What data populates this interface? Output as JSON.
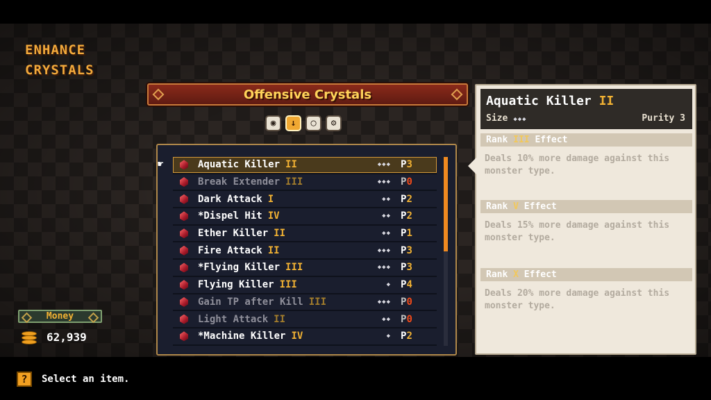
{
  "screen_title": [
    "ENHANCE",
    "CRYSTALS"
  ],
  "category": {
    "title": "Offensive Crystals",
    "icons": [
      "bag-icon",
      "sword-icon",
      "shield-icon",
      "gear-icon"
    ],
    "active_index": 1
  },
  "crystals": [
    {
      "name": "Aquatic Killer",
      "rank": "II",
      "size": "◆◆◆",
      "purity_prefix": "P",
      "purity": "3",
      "dim": false,
      "selected": true
    },
    {
      "name": "Break Extender",
      "rank": "III",
      "size": "◆◆◆",
      "purity_prefix": "P",
      "purity": "0",
      "dim": true,
      "selected": false
    },
    {
      "name": "Dark Attack",
      "rank": "I",
      "size": "◆◆",
      "purity_prefix": "P",
      "purity": "2",
      "dim": false,
      "selected": false
    },
    {
      "name": "*Dispel Hit",
      "rank": "IV",
      "size": "◆◆",
      "purity_prefix": "P",
      "purity": "2",
      "dim": false,
      "selected": false
    },
    {
      "name": "Ether Killer",
      "rank": "II",
      "size": "◆◆",
      "purity_prefix": "P",
      "purity": "1",
      "dim": false,
      "selected": false
    },
    {
      "name": "Fire Attack",
      "rank": "II",
      "size": "◆◆◆",
      "purity_prefix": "P",
      "purity": "3",
      "dim": false,
      "selected": false
    },
    {
      "name": "*Flying Killer",
      "rank": "III",
      "size": "◆◆◆",
      "purity_prefix": "P",
      "purity": "3",
      "dim": false,
      "selected": false
    },
    {
      "name": "Flying Killer",
      "rank": "III",
      "size": "◆",
      "purity_prefix": "P",
      "purity": "4",
      "dim": false,
      "selected": false
    },
    {
      "name": "Gain TP after Kill",
      "rank": "III",
      "size": "◆◆◆",
      "purity_prefix": "P",
      "purity": "0",
      "dim": true,
      "selected": false
    },
    {
      "name": "Light Attack",
      "rank": "II",
      "size": "◆◆",
      "purity_prefix": "P",
      "purity": "0",
      "dim": true,
      "selected": false
    },
    {
      "name": "*Machine Killer",
      "rank": "IV",
      "size": "◆",
      "purity_prefix": "P",
      "purity": "2",
      "dim": false,
      "selected": false
    }
  ],
  "scroll_fraction": 0.5,
  "detail": {
    "name": "Aquatic Killer",
    "rank": "II",
    "size_label": "Size",
    "size": "◆◆◆",
    "purity_label": "Purity 3",
    "effects": [
      {
        "prefix": "Rank",
        "rank": "III",
        "suffix": "Effect",
        "text": "Deals 10% more damage against this monster type."
      },
      {
        "prefix": "Rank",
        "rank": "V",
        "suffix": "Effect",
        "text": "Deals 15% more damage against this monster type."
      },
      {
        "prefix": "Rank",
        "rank": "X",
        "suffix": "Effect",
        "text": "Deals 20% more damage against this monster type."
      }
    ]
  },
  "money": {
    "label": "Money",
    "value": "62,939"
  },
  "footer": {
    "help_icon": "?",
    "help_text": "Select an item."
  }
}
